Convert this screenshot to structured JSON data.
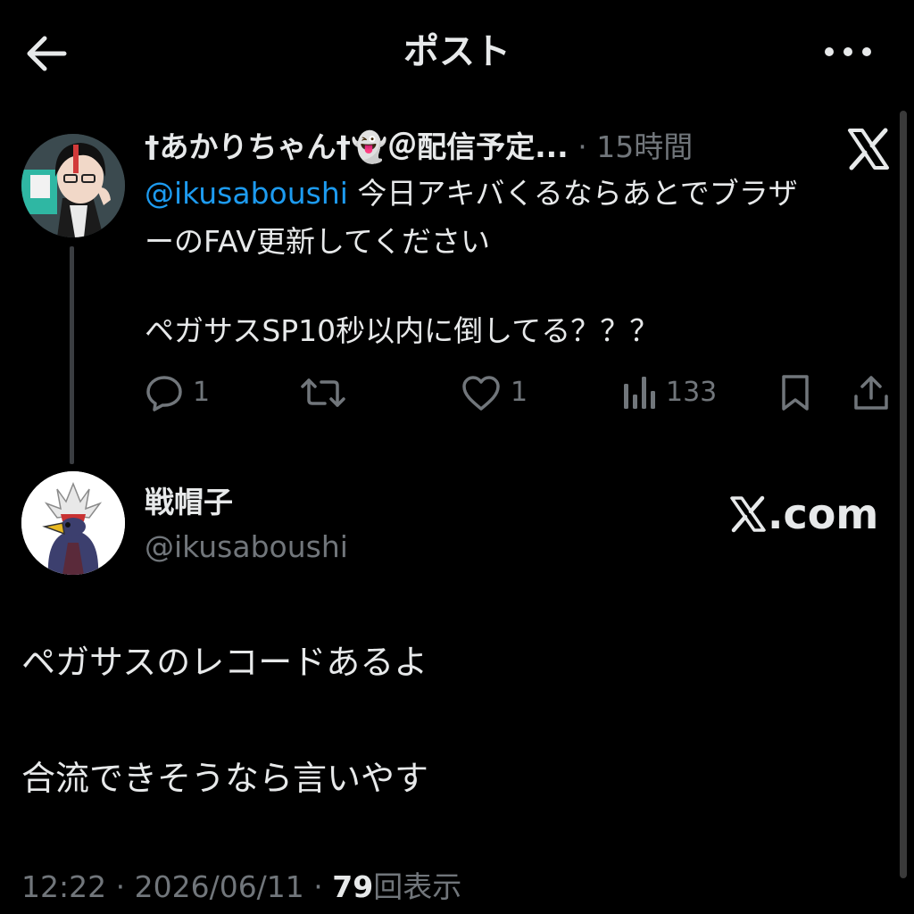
{
  "header": {
    "title": "ポスト",
    "back_icon": "arrow-left-icon",
    "more_icon": "more-horizontal-icon"
  },
  "parent_post": {
    "author": "†あかりちゃん†👻＠配信予定...",
    "separator": "·",
    "time": "15時間",
    "platform_icon": "x-logo-icon",
    "mention": "@ikusaboushi",
    "text_line1_rest": " 今日アキバくるならあとでブラザ",
    "text_line2": "ーのFAV更新してください",
    "text_line3": "ペガサスSP10秒以内に倒してる？？？",
    "actions": {
      "reply_count": "1",
      "retweet_count": "",
      "like_count": "1",
      "views_count": "133"
    }
  },
  "post": {
    "author_name": "戦帽子",
    "handle": "@ikusaboushi",
    "source_logo_text": ".com",
    "text_line1": "ペガサスのレコードあるよ",
    "text_line2": "合流できそうなら言いやす",
    "meta": {
      "time": "12:22",
      "sep1": " · ",
      "date": "2026/06/11",
      "sep2": " · ",
      "views": "79",
      "views_label": "回表示"
    }
  },
  "colors": {
    "background": "#000000",
    "text": "#e7e9ea",
    "muted": "#71767b",
    "link": "#1d9bf0"
  }
}
